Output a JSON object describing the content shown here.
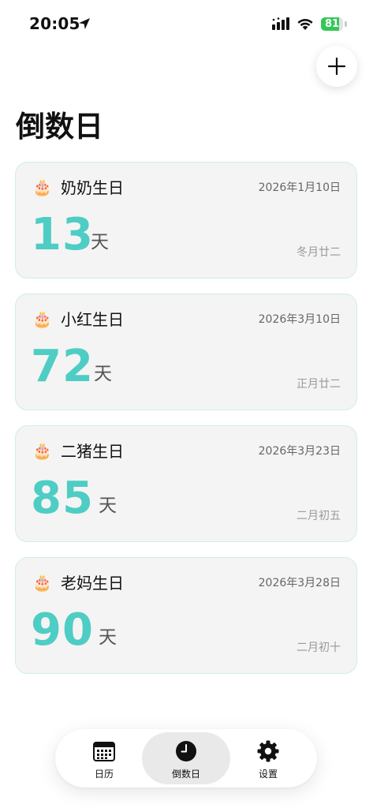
{
  "status_bar": {
    "time": "20:05",
    "battery_level": 81,
    "battery_text": "81",
    "icons": [
      "location-arrow-icon",
      "cellular-signal-icon",
      "wifi-icon",
      "battery-icon"
    ]
  },
  "header": {
    "add_icon": "plus-icon",
    "title": "倒数日"
  },
  "colors": {
    "accent": "#4ecdc4",
    "card_border": "#cfeee8",
    "card_background": "#f4f4f4",
    "battery": "#35c759"
  },
  "events": [
    {
      "emoji": "🎂",
      "name": "奶奶生日",
      "date": "2026年1月10日",
      "days": "13",
      "unit": "天",
      "lunar": "冬月廿二"
    },
    {
      "emoji": "🎂",
      "name": "小红生日",
      "date": "2026年3月10日",
      "days": "72",
      "unit": "天",
      "lunar": "正月廿二"
    },
    {
      "emoji": "🎂",
      "name": "二猪生日",
      "date": "2026年3月23日",
      "days": "85",
      "unit": "天",
      "lunar": "二月初五"
    },
    {
      "emoji": "🎂",
      "name": "老妈生日",
      "date": "2026年3月28日",
      "days": "90",
      "unit": "天",
      "lunar": "二月初十"
    }
  ],
  "tabs": [
    {
      "label": "日历",
      "icon": "calendar-icon",
      "active": false
    },
    {
      "label": "倒数日",
      "icon": "clock-icon",
      "active": true
    },
    {
      "label": "设置",
      "icon": "gear-icon",
      "active": false
    }
  ]
}
